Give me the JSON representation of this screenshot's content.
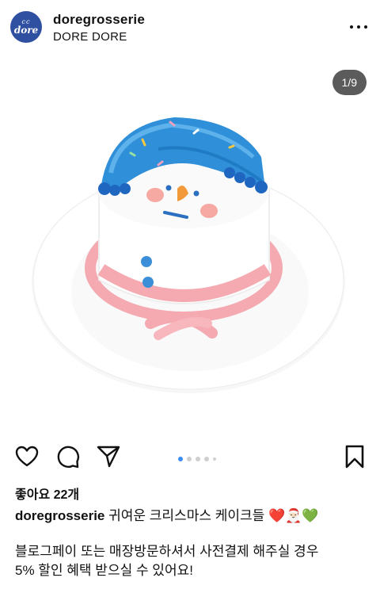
{
  "post": {
    "username": "doregrosserie",
    "location": "DORE DORE",
    "avatar_top": "cc",
    "avatar_bottom": "dore",
    "counter": "1/9",
    "likes": "좋아요 22개",
    "caption_user": "doregrosserie",
    "caption_text": "귀여운 크리스마스 케이크들 ❤️🎅🏻💚",
    "body_line1": "블로그페이 또는 매장방문하셔서 사전결제 해주실 경우",
    "body_line2": "5% 할인 혜택 받으실 수 있어요!"
  },
  "icons": [
    "heart-icon",
    "comment-icon",
    "share-icon",
    "bookmark-icon",
    "more-icon"
  ],
  "colors": {
    "pagination_active": "#3b8df0",
    "avatar_bg": "#2f4fa0"
  }
}
